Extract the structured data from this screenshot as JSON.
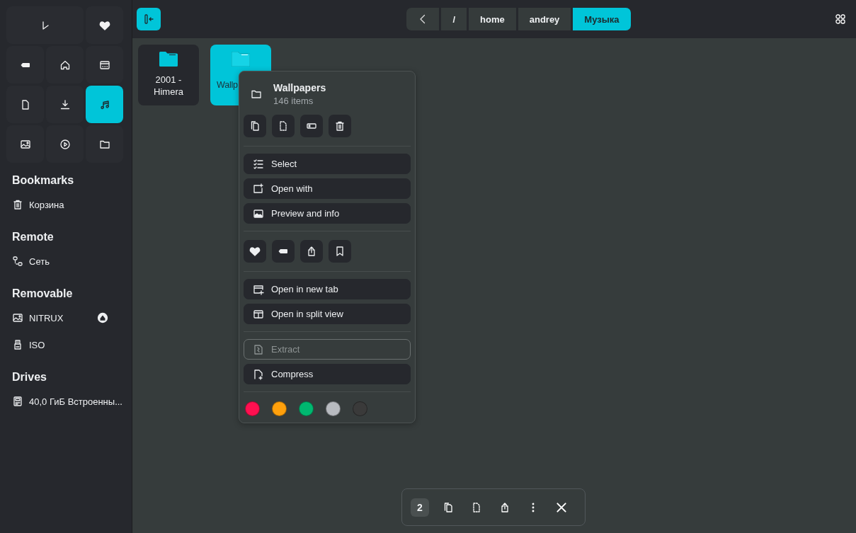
{
  "places": [
    {
      "selected": false
    },
    {
      "selected": false
    },
    {
      "selected": false
    },
    {
      "selected": false
    },
    {
      "selected": false
    },
    {
      "selected": false
    },
    {
      "selected": false
    },
    {
      "selected": true
    },
    {
      "selected": false
    },
    {
      "selected": false
    },
    {
      "selected": false
    }
  ],
  "sections": [
    {
      "title": "Bookmarks",
      "items": [
        {
          "label": "Корзина",
          "kind": "trash",
          "ejectable": false
        }
      ]
    },
    {
      "title": "Remote",
      "items": [
        {
          "label": "Сеть",
          "kind": "network",
          "ejectable": false
        }
      ]
    },
    {
      "title": "Removable",
      "items": [
        {
          "label": "NITRUX",
          "kind": "image",
          "ejectable": true
        },
        {
          "label": "ISO",
          "kind": "usb",
          "ejectable": false
        }
      ]
    },
    {
      "title": "Drives",
      "items": [
        {
          "label": "40,0 ГиБ Встроенны...",
          "kind": "drive",
          "ejectable": false
        }
      ]
    }
  ],
  "breadcrumbs": [
    {
      "label": "/",
      "selected": false
    },
    {
      "label": "home",
      "selected": false
    },
    {
      "label": "andrey",
      "selected": false
    },
    {
      "label": "Музыка",
      "selected": true
    }
  ],
  "files": [
    {
      "name": "2001 - Himera",
      "selected": false
    },
    {
      "name": "Wallp",
      "selected": true
    }
  ],
  "menu": {
    "title": "Wallpapers",
    "subtitle": "146 items",
    "actions": [
      {
        "label": "Select",
        "disabled": false
      },
      {
        "label": "Open with",
        "disabled": false
      },
      {
        "label": "Preview and info",
        "disabled": false
      }
    ],
    "view_actions": [
      {
        "label": "Open in new tab",
        "disabled": false
      },
      {
        "label": "Open in split view",
        "disabled": false
      }
    ],
    "archive_actions": [
      {
        "label": "Extract",
        "disabled": true
      },
      {
        "label": "Compress",
        "disabled": false
      }
    ],
    "colors": [
      {
        "color": "#ff1050"
      },
      {
        "color": "#ffa00c"
      },
      {
        "color": "#00b870"
      },
      {
        "color": "#b8bbc0"
      },
      {
        "color": "#3a3a3a"
      }
    ]
  },
  "selection_bar": {
    "count": "2"
  }
}
